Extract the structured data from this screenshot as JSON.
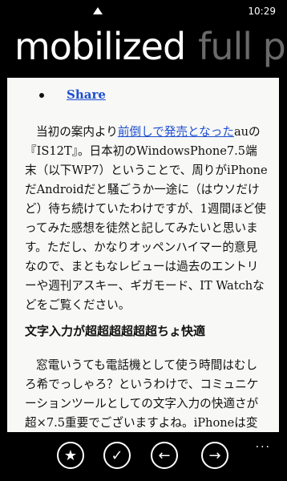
{
  "status": {
    "time": "10:29"
  },
  "pivot": {
    "active": "mobilized",
    "inactive": "full p"
  },
  "article": {
    "share_label": "Share",
    "para1": {
      "text_start": "当初の案内より",
      "link": "前倒しで発売となった",
      "text_end": "auの『IS12T』。日本初のWindowsPhone7.5端末（以下WP7）ということで、周りがiPhoneだAndroidだと騒ごうか一途に（はウソだけど）待ち続けていたわけですが、1週間ほど使ってみた感想を徒然と記してみたいと思います。ただし、かなりオッペンハイマー的意見なので、まともなレビューは過去のエントリーや週刊アスキー、ギガモード、IT Watchなどをご覧ください。"
    },
    "heading": "文字入力が超超超超超超ちょ快適",
    "para2": "窓電いうても電話機として使う時間はむしろ希でっしゃろ？というわけで、コミュニケーションツールとしての文字入力の快適さが超×7.5重要でございますよね。iPhoneは変換効率に関しては賛"
  },
  "appbar": {
    "buttons": [
      {
        "icon": "star-icon",
        "glyph": "★"
      },
      {
        "icon": "check-icon",
        "glyph": "✓"
      },
      {
        "icon": "back-arrow-icon",
        "glyph": "←"
      },
      {
        "icon": "forward-arrow-icon",
        "glyph": "→"
      }
    ],
    "more": "..."
  }
}
